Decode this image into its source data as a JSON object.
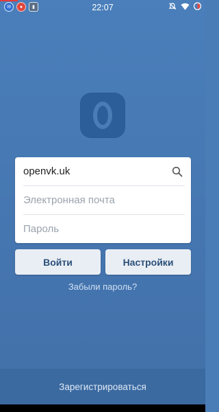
{
  "status_bar": {
    "time": "22:07",
    "left_icons": [
      "mail-notification-icon",
      "app-notification-icon",
      "sim-icon"
    ],
    "right_icons": [
      "alarm-off-icon",
      "wifi-icon",
      "battery-icon"
    ]
  },
  "logo": {
    "icon": "openvk-logo-icon"
  },
  "form": {
    "server_value": "openvk.uk",
    "email_placeholder": "Электронная почта",
    "password_placeholder": "Пароль"
  },
  "buttons": {
    "login": "Войти",
    "settings": "Настройки"
  },
  "forgot_password": "Забыли пароль?",
  "register": "Зарегистрироваться",
  "colors": {
    "background": "#4a7cb6",
    "logo_bg": "#2c5f99",
    "button_bg": "#e9eef4",
    "button_text": "#2b4f79"
  }
}
